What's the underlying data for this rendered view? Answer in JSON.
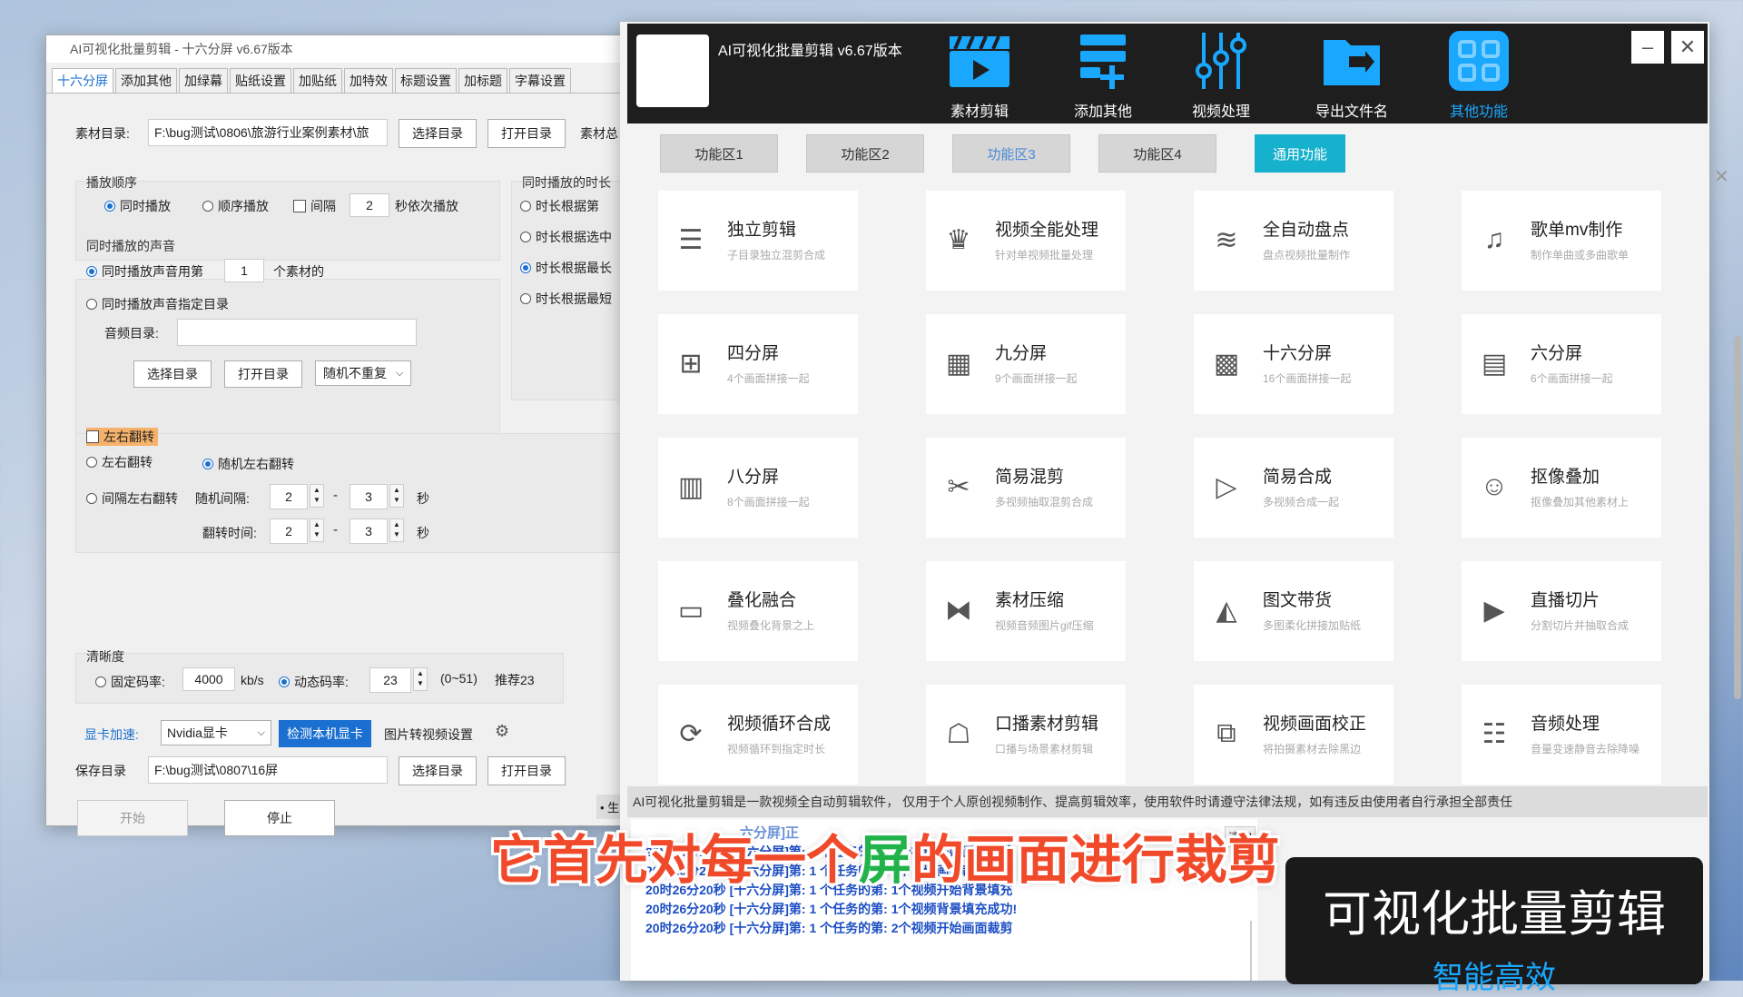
{
  "left_window": {
    "title": "AI可视化批量剪辑 - 十六分屏  v6.67版本",
    "tabs": [
      "十六分屏",
      "添加其他",
      "加绿幕",
      "贴纸设置",
      "加贴纸",
      "加特效",
      "标题设置",
      "加标题",
      "字幕设置"
    ],
    "material_dir_label": "素材目录:",
    "material_dir_value": "F:\\bug测试\\0806\\旅游行业案例素材\\旅",
    "select_dir": "选择目录",
    "open_dir": "打开目录",
    "material_total": "素材总",
    "play_order": {
      "title": "播放顺序",
      "options": [
        "同时播放",
        "顺序播放"
      ],
      "interval_label": "间隔",
      "interval_value": "2",
      "interval_suffix": "秒依次播放"
    },
    "duration": {
      "title": "同时播放的时长",
      "options": [
        "时长根据第",
        "时长根据选中",
        "时长根据最长",
        "时长根据最短"
      ]
    },
    "sound": {
      "title": "同时播放的声音",
      "use_nth_prefix": "同时播放声音用第",
      "use_nth_value": "1",
      "use_nth_suffix": "个素材的",
      "specify_dir": "同时播放声音指定目录",
      "audio_dir_label": "音频目录:",
      "audio_dir_value": "",
      "select_dir": "选择目录",
      "open_dir": "打开目录",
      "random_select": "随机不重复"
    },
    "flip": {
      "title": "左右翻转",
      "flip": "左右翻转",
      "random_flip": "随机左右翻转",
      "interval_flip": "间隔左右翻转",
      "random_interval_label": "随机间隔:",
      "ri_from": "2",
      "ri_to": "3",
      "sec": "秒",
      "flip_time_label": "翻转时间:",
      "ft_from": "2",
      "ft_to": "3",
      "dash": "-"
    },
    "clarity": {
      "title": "清晰度",
      "fixed_label": "固定码率:",
      "fixed_value": "4000",
      "unit": "kb/s",
      "dynamic_label": "动态码率:",
      "dynamic_value": "23",
      "range": "(0~51)",
      "recommend": "推荐23"
    },
    "gpu_label": "显卡加速:",
    "gpu_value": "Nvidia显卡",
    "detect_gpu": "检测本机显卡",
    "image_to_video": "图片转视频设置",
    "save_dir_label": "保存目录",
    "save_dir_value": "F:\\bug测试\\0807\\16屏",
    "save_select": "选择目录",
    "save_open": "打开目录",
    "start": "开始",
    "stop": "停止",
    "side_text": "• 生"
  },
  "right_window": {
    "title": "AI可视化批量剪辑 v6.67版本",
    "nav": [
      "素材剪辑",
      "添加其他",
      "视频处理",
      "导出文件名",
      "其他功能"
    ],
    "func_tabs": [
      "功能区1",
      "功能区2",
      "功能区3",
      "功能区4",
      "通用功能"
    ],
    "cards": [
      {
        "title": "独立剪辑",
        "sub": "子目录独立混剪合成",
        "icon": "list-icon"
      },
      {
        "title": "视频全能处理",
        "sub": "针对单视频批量处理",
        "icon": "crown-icon"
      },
      {
        "title": "全自动盘点",
        "sub": "盘点视频批量制作",
        "icon": "layers-icon"
      },
      {
        "title": "歌单mv制作",
        "sub": "制作单曲或多曲歌单",
        "icon": "music-doc-icon"
      },
      {
        "title": "四分屏",
        "sub": "4个画面拼接一起",
        "icon": "grid-4-icon"
      },
      {
        "title": "九分屏",
        "sub": "9个画面拼接一起",
        "icon": "grid-9-icon"
      },
      {
        "title": "十六分屏",
        "sub": "16个画面拼接一起",
        "icon": "grid-16-icon"
      },
      {
        "title": "六分屏",
        "sub": "6个画面拼接一起",
        "icon": "grid-6-icon"
      },
      {
        "title": "八分屏",
        "sub": "8个画面拼接一起",
        "icon": "grid-8-icon"
      },
      {
        "title": "简易混剪",
        "sub": "多视频抽取混剪合成",
        "icon": "scissors-icon"
      },
      {
        "title": "简易合成",
        "sub": "多视频合成一起",
        "icon": "video-file-icon"
      },
      {
        "title": "抠像叠加",
        "sub": "抠像叠加其他素材上",
        "icon": "portrait-icon"
      },
      {
        "title": "叠化融合",
        "sub": "视频叠化背景之上",
        "icon": "overlay-icon"
      },
      {
        "title": "素材压缩",
        "sub": "视频音频图片gif压缩",
        "icon": "compress-icon"
      },
      {
        "title": "图文带货",
        "sub": "多图柔化拼接加贴纸",
        "icon": "image-icon"
      },
      {
        "title": "直播切片",
        "sub": "分割切片并抽取合成",
        "icon": "camera-icon"
      },
      {
        "title": "视频循环合成",
        "sub": "视频循环到指定时长",
        "icon": "loop-icon"
      },
      {
        "title": "口播素材剪辑",
        "sub": "口播与场景素材剪辑",
        "icon": "robot-icon"
      },
      {
        "title": "视频画面校正",
        "sub": "将拍摄素材去除黑边",
        "icon": "correct-icon"
      },
      {
        "title": "音频处理",
        "sub": "音量变速静音去除降噪",
        "icon": "sliders-icon"
      }
    ],
    "notice": "AI可视化批量剪辑是一款视频全自动剪辑软件，  仅用于个人原创视频制作、提高剪辑效率，使用软件时请遵守法律法规，如有违反由使用者自行承担全部责任",
    "log_partial": "六分屏]正",
    "clear": "清空",
    "log": [
      "20时26分19秒 [十六分屏]第: 1 个任务的第: 1个视频开始画面裁剪",
      "20时26分20秒 [十六分屏]第: 1 个任务的第: 1个视频画面裁剪成功!",
      "20时26分20秒 [十六分屏]第: 1 个任务的第: 1个视频开始背景填充",
      "20时26分20秒 [十六分屏]第: 1 个任务的第: 1个视频背景填充成功!",
      "20时26分20秒 [十六分屏]第: 1 个任务的第: 2个视频开始画面裁剪"
    ],
    "promo_title": "可视化批量剪辑",
    "promo_sub": "智能高效"
  },
  "subtitle": {
    "part1": "它首先对每一个",
    "part2": "屏",
    "part3": "的画面进行裁剪"
  },
  "colors": {
    "accent": "#1a6fd0",
    "nav_active": "#1aa8ff",
    "general_tab": "#16b1cc",
    "subtitle_red": "#f14a2b",
    "log_blue": "#1d4fc4"
  }
}
